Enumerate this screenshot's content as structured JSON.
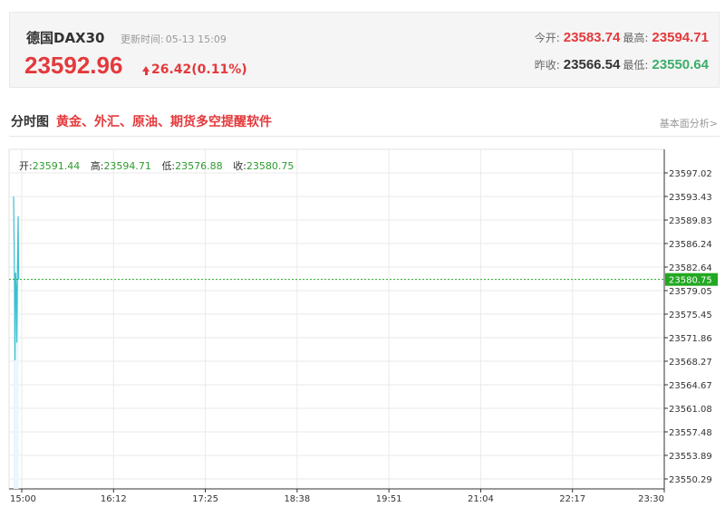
{
  "quote": {
    "name": "德国DAX30",
    "update_label": "更新时间:",
    "update_time": "05-13 15:09",
    "price": "23592.96",
    "change": "26.42(0.11%)",
    "open_label": "今开:",
    "open": "23583.74",
    "high_label": "最高:",
    "high": "23594.71",
    "prev_close_label": "昨收:",
    "prev_close": "23566.54",
    "low_label": "最低:",
    "low": "23550.64"
  },
  "section": {
    "title": "分时图",
    "promo_link": "黄金、外汇、原油、期货多空提醒软件",
    "fundamentals_link": "基本面分析>"
  },
  "ohlc": {
    "open_label": "开:",
    "open": "23591.44",
    "high_label": "高:",
    "high": "23594.71",
    "low_label": "低:",
    "low": "23576.88",
    "close_label": "收:",
    "close": "23580.75"
  },
  "colors": {
    "up": "#e4393c",
    "down": "#3cad6a",
    "line": "#3bbfd1",
    "current_tag": "#22a822"
  },
  "chart_data": {
    "type": "line",
    "x_ticks": [
      "15:00",
      "16:12",
      "17:25",
      "18:38",
      "19:51",
      "21:04",
      "22:17",
      "23:30"
    ],
    "y_ticks": [
      "23597.02",
      "23593.43",
      "23589.83",
      "23586.24",
      "23582.64",
      "23579.05",
      "23575.45",
      "23571.86",
      "23568.27",
      "23564.67",
      "23561.08",
      "23557.48",
      "23553.89",
      "23550.29"
    ],
    "ylim": [
      23550.29,
      23597.02
    ],
    "current_value": "23580.75",
    "series": [
      {
        "values": [
          {
            "t": 0.0,
            "v": 23593.4
          },
          {
            "t": 1.0,
            "v": 23581.0
          },
          {
            "t": 1.5,
            "v": 23568.4
          },
          {
            "t": 2.2,
            "v": 23581.8
          },
          {
            "t": 3.0,
            "v": 23579.3
          },
          {
            "t": 3.6,
            "v": 23571.1
          },
          {
            "t": 4.3,
            "v": 23583.0
          },
          {
            "t": 5.0,
            "v": 23590.4
          },
          {
            "t": 5.6,
            "v": 23580.75
          }
        ]
      }
    ]
  }
}
